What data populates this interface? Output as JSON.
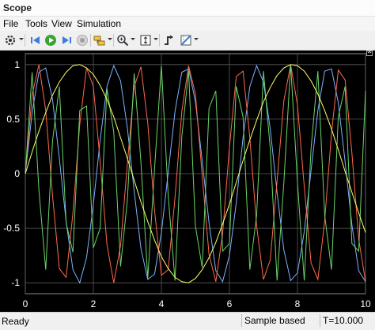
{
  "window": {
    "title": "Scope"
  },
  "menu": [
    "File",
    "Tools",
    "View",
    "Simulation"
  ],
  "toolbar": {
    "icons": [
      "settings-icon",
      "step-back-icon",
      "run-icon",
      "step-forward-icon",
      "stop-icon",
      "highlight-block-icon",
      "zoom-icon",
      "fit-axes-icon",
      "triggers-icon",
      "cursor-measurements-icon"
    ]
  },
  "status": {
    "ready": "Ready",
    "mode": "Sample based",
    "time": "T=10.000"
  },
  "colors": {
    "background": "#000000",
    "grid": "#5a5a5a",
    "axis_text": "#ffffff",
    "series": [
      "#7fb2ff",
      "#ff6a4d",
      "#6cd46a",
      "#ffff66"
    ]
  },
  "chart_data": {
    "type": "line",
    "xlim": [
      0,
      10
    ],
    "ylim": [
      -1.1,
      1.1
    ],
    "xticks": [
      0,
      2,
      4,
      6,
      8,
      10
    ],
    "yticks": [
      1,
      0.5,
      0,
      -0.5,
      -1
    ],
    "xtick_labels": [
      "0",
      "2",
      "4",
      "6",
      "8",
      "10"
    ],
    "ytick_labels": [
      "1",
      "0.5",
      "0",
      "-0.5",
      "-1"
    ],
    "grid": true,
    "series": [
      {
        "color": "#7fb2ff",
        "x": [
          0,
          0.2,
          0.4,
          0.6,
          0.8,
          1,
          1.2,
          1.4,
          1.6,
          1.8,
          2,
          2.2,
          2.4,
          2.6,
          2.8,
          3,
          3.2,
          3.4,
          3.6,
          3.8,
          4,
          4.2,
          4.4,
          4.6,
          4.8,
          5,
          5.2,
          5.4,
          5.6,
          5.8,
          6,
          6.2,
          6.4,
          6.6,
          6.8,
          7,
          7.2,
          7.4,
          7.6,
          7.8,
          8,
          8.2,
          8.4,
          8.6,
          8.8,
          9,
          9.2,
          9.4,
          9.6,
          9.8,
          10
        ],
        "y": [
          0,
          0.56,
          0.93,
          0.97,
          0.68,
          0.14,
          -0.44,
          -0.88,
          -1.0,
          -0.77,
          -0.28,
          0.31,
          0.8,
          0.99,
          0.85,
          0.42,
          -0.16,
          -0.69,
          -0.97,
          -0.92,
          -0.54,
          0.01,
          0.57,
          0.93,
          0.96,
          0.66,
          0.12,
          -0.45,
          -0.89,
          -0.99,
          -0.75,
          -0.27,
          0.33,
          0.8,
          0.99,
          0.84,
          0.41,
          -0.17,
          -0.7,
          -0.98,
          -0.91,
          -0.53,
          0.03,
          0.58,
          0.94,
          0.96,
          0.65,
          0.11,
          -0.47,
          -0.89,
          -0.99
        ]
      },
      {
        "color": "#ff6a4d",
        "x": [
          0,
          0.2,
          0.4,
          0.6,
          0.8,
          1,
          1.2,
          1.4,
          1.6,
          1.8,
          2,
          2.2,
          2.4,
          2.6,
          2.8,
          3,
          3.2,
          3.4,
          3.6,
          3.8,
          4,
          4.2,
          4.4,
          4.6,
          4.8,
          5,
          5.2,
          5.4,
          5.6,
          5.8,
          6,
          6.2,
          6.4,
          6.6,
          6.8,
          7,
          7.2,
          7.4,
          7.6,
          7.8,
          8,
          8.2,
          8.4,
          8.6,
          8.8,
          9,
          9.2,
          9.4,
          9.6,
          9.8,
          10
        ],
        "y": [
          0,
          0.72,
          1.0,
          0.58,
          -0.2,
          -0.87,
          -0.95,
          -0.36,
          0.45,
          0.97,
          0.8,
          0.11,
          -0.65,
          -1.0,
          -0.66,
          0.09,
          0.8,
          0.98,
          0.46,
          -0.34,
          -0.93,
          -0.88,
          -0.22,
          0.57,
          0.99,
          0.73,
          -0.02,
          -0.74,
          -0.99,
          -0.55,
          0.24,
          0.89,
          0.94,
          0.33,
          -0.48,
          -0.97,
          -0.79,
          -0.07,
          0.67,
          1.0,
          0.63,
          -0.12,
          -0.82,
          -0.97,
          -0.43,
          0.37,
          0.95,
          0.86,
          0.19,
          -0.6,
          -0.99
        ]
      },
      {
        "color": "#6cd46a",
        "x": [
          0,
          0.2,
          0.4,
          0.6,
          0.8,
          1,
          1.2,
          1.4,
          1.6,
          1.8,
          2,
          2.2,
          2.4,
          2.6,
          2.8,
          3,
          3.2,
          3.4,
          3.6,
          3.8,
          4,
          4.2,
          4.4,
          4.6,
          4.8,
          5,
          5.2,
          5.4,
          5.6,
          5.8,
          6,
          6.2,
          6.4,
          6.6,
          6.8,
          7,
          7.2,
          7.4,
          7.6,
          7.8,
          8,
          8.2,
          8.4,
          8.6,
          8.8,
          9,
          9.2,
          9.4,
          9.6,
          9.8,
          10
        ],
        "y": [
          0,
          0.93,
          -0.15,
          -0.88,
          0.3,
          0.8,
          -0.45,
          -0.72,
          0.58,
          0.62,
          -0.68,
          -0.5,
          0.78,
          0.38,
          -0.85,
          -0.24,
          0.92,
          0.1,
          -0.96,
          0.05,
          0.99,
          -0.2,
          -0.98,
          0.34,
          0.94,
          -0.48,
          -0.86,
          0.6,
          0.76,
          -0.71,
          -0.64,
          0.8,
          0.52,
          -0.88,
          -0.38,
          0.94,
          0.23,
          -0.98,
          -0.08,
          1.0,
          -0.08,
          -0.98,
          0.23,
          0.94,
          -0.38,
          -0.88,
          0.52,
          0.8,
          -0.64,
          -0.71,
          0.76
        ]
      },
      {
        "color": "#ffff66",
        "x": [
          0,
          0.2,
          0.4,
          0.6,
          0.8,
          1,
          1.2,
          1.4,
          1.6,
          1.8,
          2,
          2.2,
          2.4,
          2.6,
          2.8,
          3,
          3.2,
          3.4,
          3.6,
          3.8,
          4,
          4.2,
          4.4,
          4.6,
          4.8,
          5,
          5.2,
          5.4,
          5.6,
          5.8,
          6,
          6.2,
          6.4,
          6.6,
          6.8,
          7,
          7.2,
          7.4,
          7.6,
          7.8,
          8,
          8.2,
          8.4,
          8.6,
          8.8,
          9,
          9.2,
          9.4,
          9.6,
          9.8,
          10
        ],
        "y": [
          0,
          0.2,
          0.39,
          0.56,
          0.72,
          0.84,
          0.93,
          0.99,
          1.0,
          0.97,
          0.91,
          0.81,
          0.68,
          0.52,
          0.33,
          0.14,
          -0.06,
          -0.26,
          -0.44,
          -0.61,
          -0.76,
          -0.87,
          -0.95,
          -0.99,
          -1.0,
          -0.96,
          -0.88,
          -0.77,
          -0.63,
          -0.46,
          -0.28,
          -0.08,
          0.12,
          0.31,
          0.49,
          0.66,
          0.79,
          0.9,
          0.97,
          1.0,
          0.99,
          0.94,
          0.85,
          0.73,
          0.58,
          0.41,
          0.22,
          0.02,
          -0.17,
          -0.36,
          -0.54
        ]
      }
    ]
  }
}
